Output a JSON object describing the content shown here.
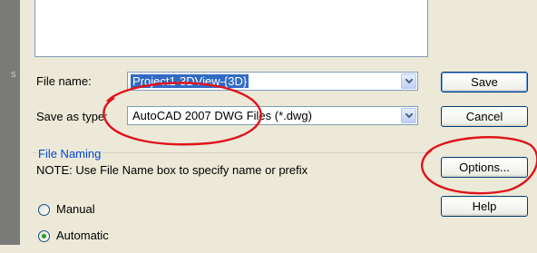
{
  "left_strip_glyph": "s",
  "file_name": {
    "label": "File name:",
    "value": "Project1-3DView-{3D}"
  },
  "save_as_type": {
    "label": "Save as type:",
    "value": "AutoCAD 2007 DWG Files (*.dwg)"
  },
  "buttons": {
    "save": "Save",
    "cancel": "Cancel",
    "options": "Options...",
    "help": "Help"
  },
  "file_naming": {
    "title": "File Naming",
    "note": "NOTE: Use File Name box to specify name or prefix",
    "options": [
      {
        "label": "Manual",
        "selected": false
      },
      {
        "label": "Automatic",
        "selected": true
      }
    ]
  },
  "colors": {
    "annotation_red": "#e0141c",
    "selection_blue": "#316ac5",
    "group_title_blue": "#0046d5"
  }
}
